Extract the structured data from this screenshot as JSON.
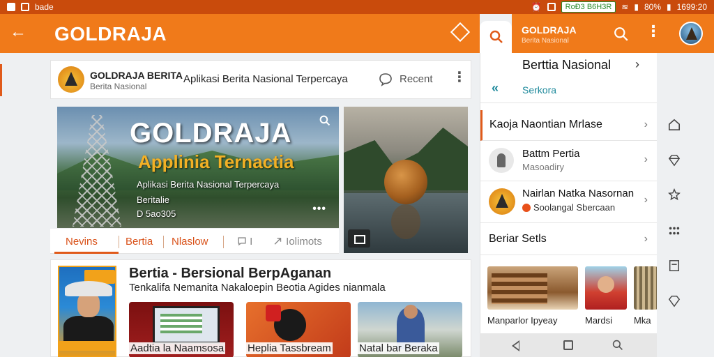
{
  "status_bar": {
    "left_text": "bade",
    "pill_text": "RoÐ3 B6H3R",
    "battery_text": "80%",
    "time": "1699:20"
  },
  "app_bar": {
    "title": "GOLDRAJA",
    "back_icon": "arrow-left-icon",
    "action_icon": "diamond-icon"
  },
  "secondary_bar": {
    "title": "GOLDRAJA",
    "subtitle": "Berita Nasional",
    "search_icon": "search-icon",
    "more_icon": "more-vertical-icon"
  },
  "header_card": {
    "name": "GOLDRAJA BERITA",
    "sub": "Berita Nasional",
    "tagline": "Aplikasi Berita Nasional Terpercaya",
    "recent": "Recent"
  },
  "hero": {
    "title": "GOLDRAJA",
    "subtitle": "Applinia Ternactia",
    "description": "Aplikasi Berita Nasional Terpercaya",
    "line_a": "Beritalie",
    "line_b": "D 5ao305",
    "more": "•••"
  },
  "tabs": [
    {
      "label": "Nevins"
    },
    {
      "label": "Bertia"
    },
    {
      "label": "Nlaslow"
    },
    {
      "label": "I"
    },
    {
      "label": "Iolimots"
    }
  ],
  "lower_card": {
    "title": "Bertia - Bersional  BerpAganan",
    "subtitle": "Tenkalifa Nemanita Nakaloepin Beotia Agides nianmala",
    "thumbs": [
      {
        "label": "Aadtia la Naamsosa"
      },
      {
        "label": "Heplia Tassbream"
      },
      {
        "label": "Natal bar Beraka"
      }
    ]
  },
  "right_panel": {
    "head_title": "Berttia Nasional",
    "head_link": "Serkora",
    "rows": [
      {
        "title": "Kaoja Naontian Mrlase"
      },
      {
        "title": "Battm Pertia",
        "sub": "Masoadiry"
      },
      {
        "title": "Nairlan Natka Nasornan",
        "sub": "Soolangal Sbercaan"
      },
      {
        "title": "Beriar Setls"
      }
    ],
    "gallery": [
      {
        "label": "Manparlor Ipyeay"
      },
      {
        "label": "Mardsi"
      },
      {
        "label": "Mka"
      }
    ]
  },
  "rail_icons": [
    "home-icon",
    "gem-icon",
    "star-icon",
    "grid-dots-icon",
    "document-icon",
    "gem-icon"
  ],
  "colors": {
    "accent": "#f07a1a",
    "accent_dark": "#c94b0c",
    "link": "#1f8a9c"
  }
}
